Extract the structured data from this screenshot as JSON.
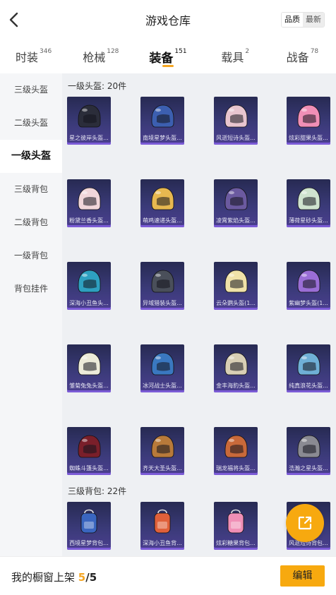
{
  "header": {
    "title": "游戏仓库",
    "sort": {
      "quality_label": "品质",
      "latest_label": "最新"
    }
  },
  "tabs": [
    {
      "label": "时装",
      "count": "346"
    },
    {
      "label": "枪械",
      "count": "128"
    },
    {
      "label": "装备",
      "count": "151",
      "active": true
    },
    {
      "label": "载具",
      "count": "2"
    },
    {
      "label": "战备",
      "count": "78"
    }
  ],
  "side": [
    {
      "label": "三级头盔"
    },
    {
      "label": "二级头盔"
    },
    {
      "label": "一级头盔",
      "active": true
    },
    {
      "label": "三级背包"
    },
    {
      "label": "二级背包"
    },
    {
      "label": "一级背包"
    },
    {
      "label": "背包挂件"
    }
  ],
  "sections": [
    {
      "title": "一级头盔: 20件",
      "items": [
        {
          "label": "星之彼岸头盔...",
          "color": "#2b2d3a"
        },
        {
          "label": "南境星梦头盔...",
          "color": "#3c5fb0"
        },
        {
          "label": "风逝短诗头盔...",
          "color": "#e8c5cf"
        },
        {
          "label": "炫彩甜果头盔...",
          "color": "#f08fb6"
        },
        {
          "label": "粉黛兰香头盔...",
          "color": "#f1d6da"
        },
        {
          "label": "萌鸡速递头盔...",
          "color": "#e7b850"
        },
        {
          "label": "凌霄紫焰头盔...",
          "color": "#6b5aa0"
        },
        {
          "label": "薄荷星砂头盔...",
          "color": "#cfe3cf"
        },
        {
          "label": "深海小丑鱼头...",
          "color": "#2ea0c0"
        },
        {
          "label": "异域猎装头盔...",
          "color": "#4a4f5a"
        },
        {
          "label": "云朵鹦头盔(1...",
          "color": "#f0e2a8"
        },
        {
          "label": "紫幽梦头盔(1...",
          "color": "#9a6ed6"
        },
        {
          "label": "雏菊兔兔头盔...",
          "color": "#ecebd9"
        },
        {
          "label": "冰河战士头盔...",
          "color": "#3a78c0"
        },
        {
          "label": "金丰海豹头盔...",
          "color": "#d8cfb5"
        },
        {
          "label": "纯真浪花头盔...",
          "color": "#6fb0d6"
        },
        {
          "label": "蜘蛛斗篷头盔...",
          "color": "#7a1f2a"
        },
        {
          "label": "齐天大圣头盔...",
          "color": "#b87a3a"
        },
        {
          "label": "瑞龙福将头盔...",
          "color": "#c8693a"
        },
        {
          "label": "浩瀚之星头盔...",
          "color": "#8a8a92"
        }
      ]
    },
    {
      "title": "三级背包: 22件",
      "items": [
        {
          "label": "西境星梦背包...",
          "color": "#3a66c0"
        },
        {
          "label": "深海小丑鱼背...",
          "color": "#e0603a"
        },
        {
          "label": "炫彩糖果背包...",
          "color": "#f08fb6"
        },
        {
          "label": "风逝短诗背包...",
          "color": "#e8c5cf"
        }
      ]
    }
  ],
  "bottom": {
    "showcase_label": "我的橱窗上架",
    "showcase_current": "5",
    "showcase_total": "/5",
    "edit_label": "编辑"
  },
  "colors": {
    "accent": "#f7a90f",
    "side_bg": "#f5f6f8",
    "content_bg": "#eef0f3",
    "item_bg": "#3a3a78"
  }
}
